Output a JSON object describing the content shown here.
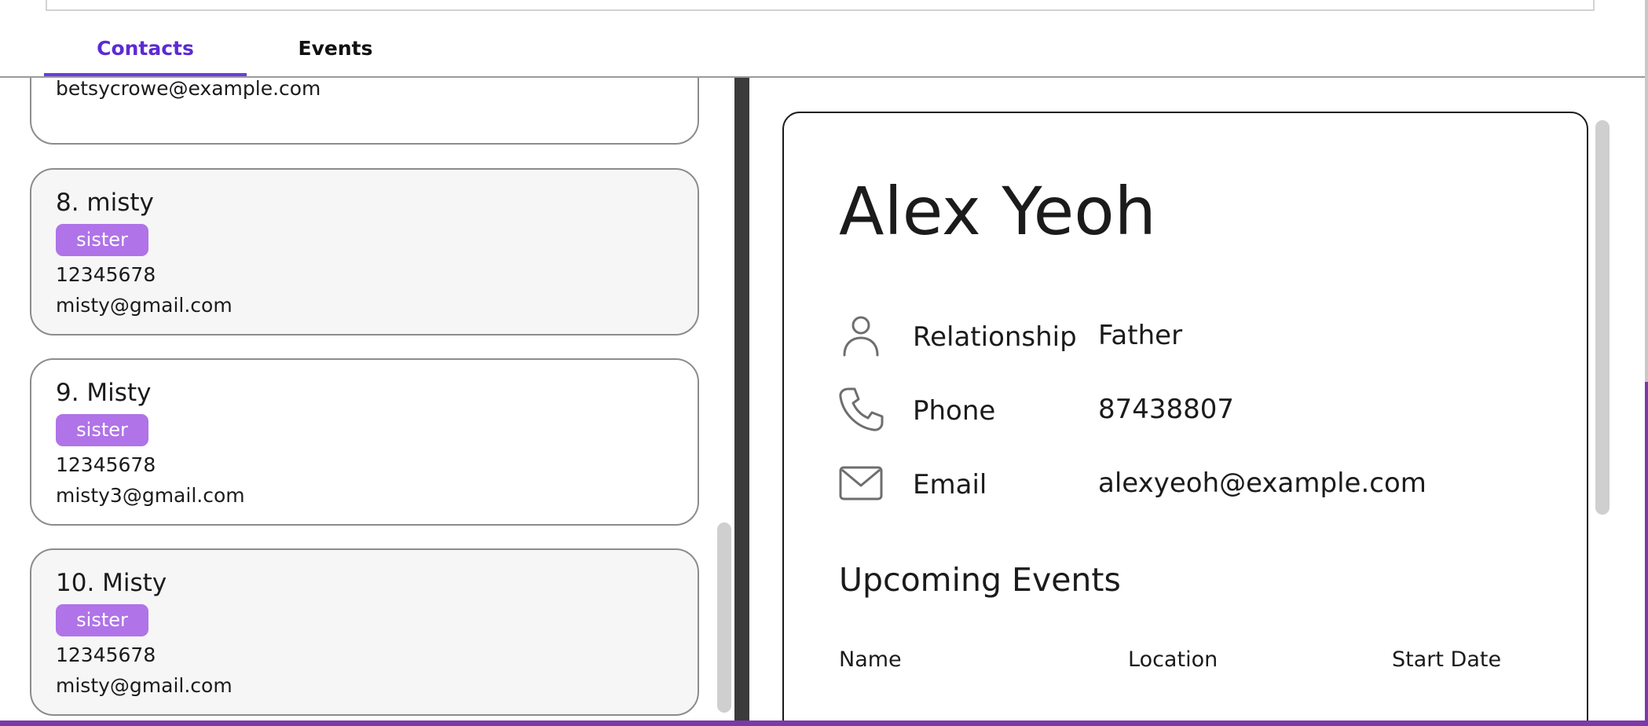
{
  "tabs": [
    {
      "label": "Contacts"
    },
    {
      "label": "Events"
    }
  ],
  "contacts": [
    {
      "email": "betsycrowe@example.com"
    },
    {
      "name": "8. misty",
      "tag": "sister",
      "phone": "12345678",
      "email": "misty@gmail.com"
    },
    {
      "name": "9. Misty",
      "tag": "sister",
      "phone": "12345678",
      "email": "misty3@gmail.com"
    },
    {
      "name": "10. Misty",
      "tag": "sister",
      "phone": "12345678",
      "email": "misty@gmail.com"
    }
  ],
  "detail": {
    "name": "Alex Yeoh",
    "fields": [
      {
        "icon": "person-icon",
        "label": "Relationship",
        "value": "Father"
      },
      {
        "icon": "phone-icon",
        "label": "Phone",
        "value": "87438807"
      },
      {
        "icon": "envelope-icon",
        "label": "Email",
        "value": "alexyeoh@example.com"
      }
    ],
    "upcoming_title": "Upcoming Events",
    "columns": [
      "Name",
      "Location",
      "Start Date"
    ]
  },
  "colors": {
    "accent": "#5b2bd3",
    "tag": "#b073e8",
    "bottom_bar": "#7b3aa8"
  }
}
